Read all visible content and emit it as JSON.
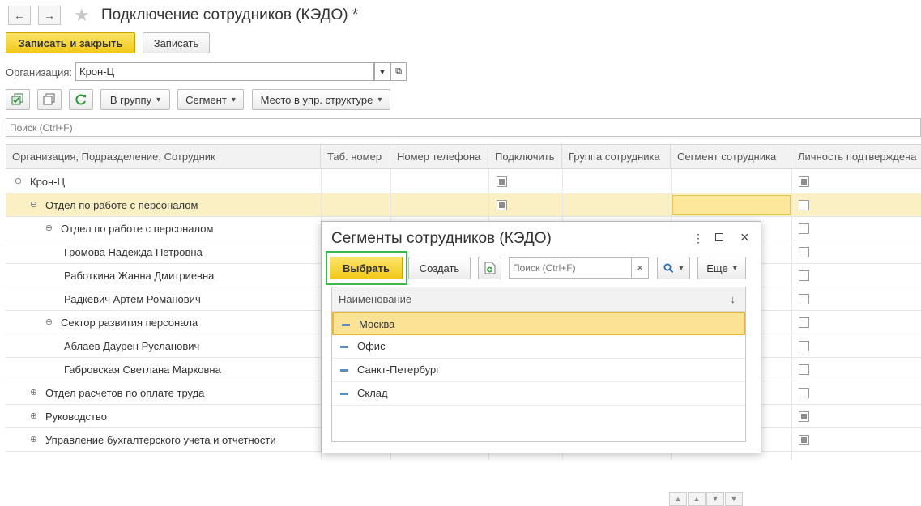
{
  "window": {
    "title": "Подключение сотрудников (КЭДО) *"
  },
  "toolbar": {
    "write_close": "Записать и закрыть",
    "write": "Записать",
    "org_label": "Организация:",
    "org_value": "Крон-Ц",
    "group_btn": "В группу",
    "segment_btn": "Сегмент",
    "place_btn": "Место в упр. структуре",
    "search_placeholder": "Поиск (Ctrl+F)"
  },
  "table": {
    "columns": [
      "Организация, Подразделение, Сотрудник",
      "Таб. номер",
      "Номер телефона",
      "Подключить",
      "Группа сотрудника",
      "Сегмент сотрудника",
      "Личность подтверждена"
    ],
    "rows": [
      {
        "text": "Крон-Ц",
        "toggle": "⊖",
        "connect": "gray",
        "confirmed": "gray"
      },
      {
        "text": "Отдел по работе с персоналом",
        "toggle": "⊖",
        "connect": "gray",
        "confirmed": "empty"
      },
      {
        "text": "Отдел по работе с персоналом",
        "toggle": "⊖",
        "connect": "",
        "confirmed": "empty"
      },
      {
        "text": "Громова Надежда Петровна",
        "toggle": "",
        "connect": "",
        "confirmed": "empty"
      },
      {
        "text": "Работкина Жанна Дмитриевна",
        "toggle": "",
        "connect": "",
        "confirmed": "empty"
      },
      {
        "text": "Радкевич Артем Романович",
        "toggle": "",
        "connect": "",
        "confirmed": "empty"
      },
      {
        "text": "Сектор развития персонала",
        "toggle": "⊖",
        "connect": "",
        "confirmed": "empty"
      },
      {
        "text": "Аблаев Даурен Русланович",
        "toggle": "",
        "connect": "",
        "confirmed": "empty"
      },
      {
        "text": "Габровская Светлана Марковна",
        "toggle": "",
        "connect": "",
        "confirmed": "empty"
      },
      {
        "text": "Отдел расчетов по оплате труда",
        "toggle": "⊕",
        "connect": "",
        "confirmed": "empty"
      },
      {
        "text": "Руководство",
        "toggle": "⊕",
        "connect": "",
        "confirmed": "gray"
      },
      {
        "text": "Управление бухгалтерского учета и отчетности",
        "toggle": "⊕",
        "connect": "",
        "confirmed": "gray"
      }
    ]
  },
  "dialog": {
    "title": "Сегменты сотрудников (КЭДО)",
    "select_btn": "Выбрать",
    "create_btn": "Создать",
    "search_placeholder": "Поиск (Ctrl+F)",
    "clear": "×",
    "more_btn": "Еще",
    "column": "Наименование",
    "sort_arrow": "↓",
    "items": [
      "Москва",
      "Офис",
      "Санкт-Петербург",
      "Склад"
    ]
  },
  "colors": {
    "accent_yellow": "#f2c919",
    "selection_row": "#fbf0c4",
    "focus_green": "#3cb84f"
  }
}
